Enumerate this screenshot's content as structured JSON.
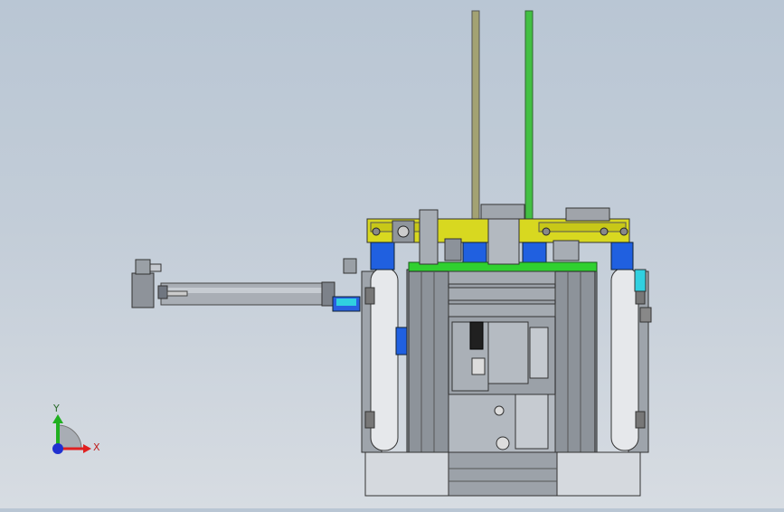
{
  "triad": {
    "x_label": "X",
    "y_label": "Y",
    "x_color": "#e02020",
    "y_color": "#20b020",
    "z_color": "#2030d0"
  },
  "colors": {
    "background_top": "#b9c6d4",
    "background_bottom": "#d7dce2",
    "frame_gray": "#9aa0a8",
    "yellow_plate": "#d8d820",
    "blue_block": "#2060e0",
    "green_strip": "#30d030",
    "cyan_part": "#30d0e0",
    "rod_olive": "#a0a070",
    "rod_green": "#40c040"
  },
  "model": {
    "icon": "cad-assembly-model"
  }
}
